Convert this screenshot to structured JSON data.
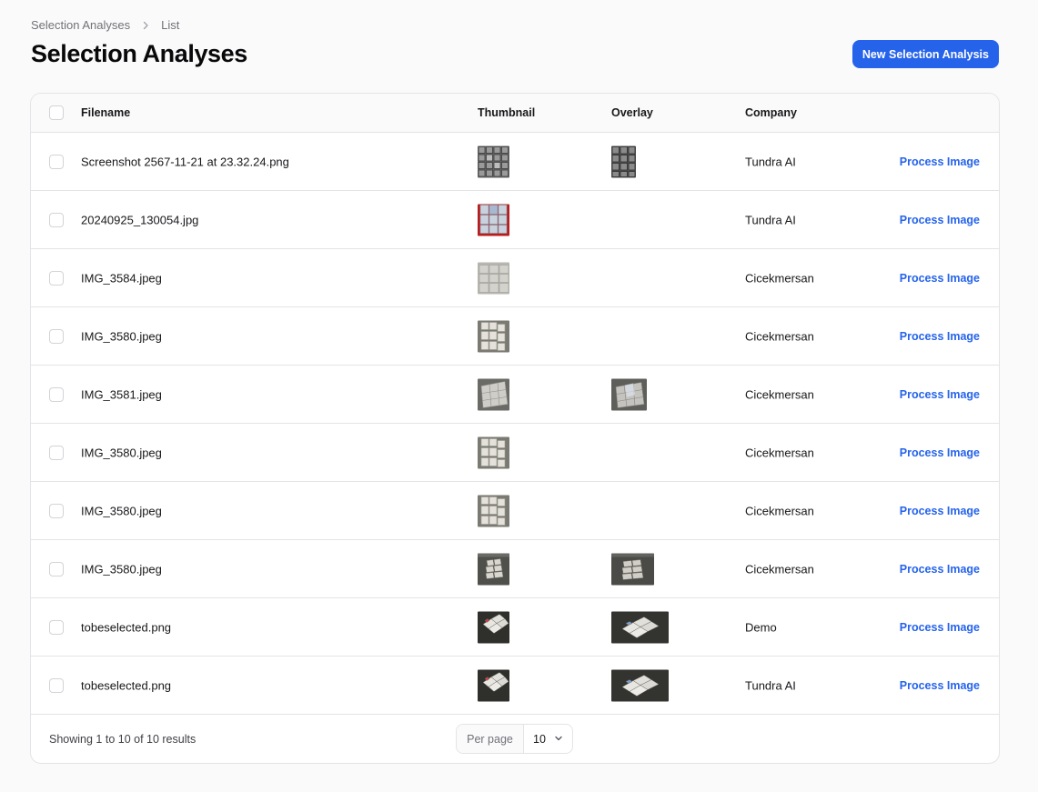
{
  "breadcrumb": {
    "parent": "Selection Analyses",
    "current": "List"
  },
  "page": {
    "title": "Selection Analyses",
    "new_button": "New Selection Analysis"
  },
  "table": {
    "headers": {
      "filename": "Filename",
      "thumbnail": "Thumbnail",
      "overlay": "Overlay",
      "company": "Company"
    },
    "rows": [
      {
        "filename": "Screenshot 2567-11-21 at 23.32.24.png",
        "company": "Tundra AI",
        "action": "Process Image"
      },
      {
        "filename": "20240925_130054.jpg",
        "company": "Tundra AI",
        "action": "Process Image"
      },
      {
        "filename": "IMG_3584.jpeg",
        "company": "Cicekmersan",
        "action": "Process Image"
      },
      {
        "filename": "IMG_3580.jpeg",
        "company": "Cicekmersan",
        "action": "Process Image"
      },
      {
        "filename": "IMG_3581.jpeg",
        "company": "Cicekmersan",
        "action": "Process Image"
      },
      {
        "filename": "IMG_3580.jpeg",
        "company": "Cicekmersan",
        "action": "Process Image"
      },
      {
        "filename": "IMG_3580.jpeg",
        "company": "Cicekmersan",
        "action": "Process Image"
      },
      {
        "filename": "IMG_3580.jpeg",
        "company": "Cicekmersan",
        "action": "Process Image"
      },
      {
        "filename": "tobeselected.png",
        "company": "Demo",
        "action": "Process Image"
      },
      {
        "filename": "tobeselected.png",
        "company": "Tundra AI",
        "action": "Process Image"
      }
    ]
  },
  "footer": {
    "showing": "Showing 1 to 10 of 10 results",
    "per_page_label": "Per page",
    "per_page_value": "10"
  },
  "colors": {
    "accent": "#2563eb",
    "border": "#e4e4e7",
    "background": "#fafafa"
  }
}
